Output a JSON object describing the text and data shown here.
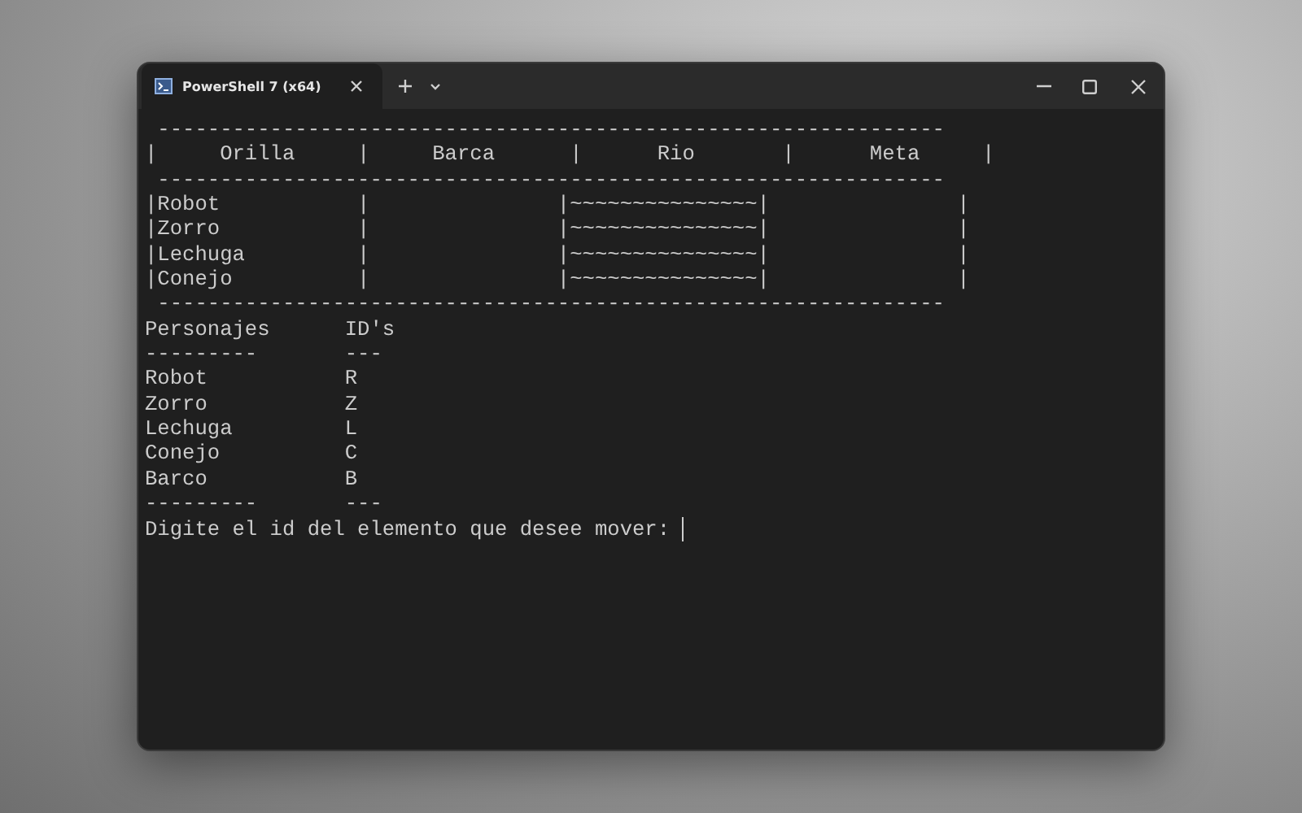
{
  "window": {
    "tab_title": "PowerShell 7 (x64)"
  },
  "terminal": {
    "lines": [
      " ---------------------------------------------------------------",
      "|     Orilla     |     Barca      |      Rio       |      Meta     |",
      " ---------------------------------------------------------------",
      "|Robot           |               |~~~~~~~~~~~~~~~|               |",
      "|Zorro           |               |~~~~~~~~~~~~~~~|               |",
      "|Lechuga         |               |~~~~~~~~~~~~~~~|               |",
      "|Conejo          |               |~~~~~~~~~~~~~~~|               |",
      " ---------------------------------------------------------------",
      "Personajes      ID's",
      "---------       ---",
      "Robot           R",
      "Zorro           Z",
      "Lechuga         L",
      "Conejo          C",
      "Barco           B",
      "---------       ---"
    ],
    "prompt": "Digite el id del elemento que desee mover: "
  }
}
